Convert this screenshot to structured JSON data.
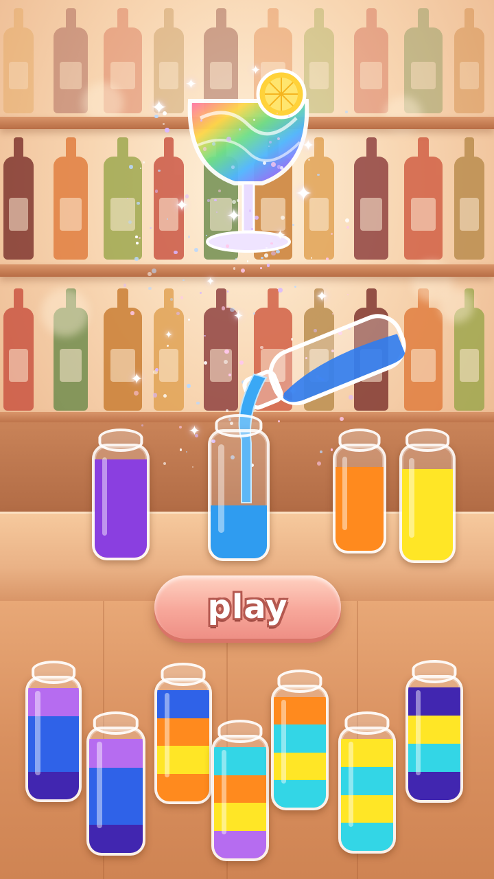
{
  "game": {
    "play_label": "play",
    "colors": {
      "purple": "#8a3fe0",
      "lavender": "#b66cf0",
      "blue": "#2f62e8",
      "navy": "#4126b0",
      "sky": "#2f9cf0",
      "orange": "#ff8a1e",
      "yellow": "#ffe626",
      "cyan": "#33d6e6",
      "rainbow_pour": "#3aa8f5"
    },
    "top_vials": [
      {
        "name": "top-vial-purple",
        "layers": [
          "purple"
        ],
        "fill": 0.88
      },
      {
        "name": "top-vial-blue",
        "layers": [
          "sky"
        ],
        "fill": 0.42
      },
      {
        "name": "top-vial-orange",
        "layers": [
          "orange"
        ],
        "fill": 0.8
      },
      {
        "name": "top-vial-yellow",
        "layers": [
          "yellow"
        ],
        "fill": 0.8
      }
    ],
    "bottom_vials": [
      {
        "name": "bottom-vial-1",
        "layers": [
          "navy",
          "blue",
          "blue",
          "lavender"
        ]
      },
      {
        "name": "bottom-vial-2",
        "layers": [
          "navy",
          "blue",
          "blue",
          "lavender"
        ]
      },
      {
        "name": "bottom-vial-3",
        "layers": [
          "orange",
          "yellow",
          "orange",
          "blue"
        ]
      },
      {
        "name": "bottom-vial-4",
        "layers": [
          "lavender",
          "yellow",
          "orange",
          "cyan"
        ]
      },
      {
        "name": "bottom-vial-5",
        "layers": [
          "cyan",
          "yellow",
          "cyan",
          "orange"
        ]
      },
      {
        "name": "bottom-vial-6",
        "layers": [
          "cyan",
          "yellow",
          "cyan",
          "yellow"
        ]
      },
      {
        "name": "bottom-vial-7",
        "layers": [
          "navy",
          "cyan",
          "yellow",
          "navy"
        ]
      }
    ]
  }
}
